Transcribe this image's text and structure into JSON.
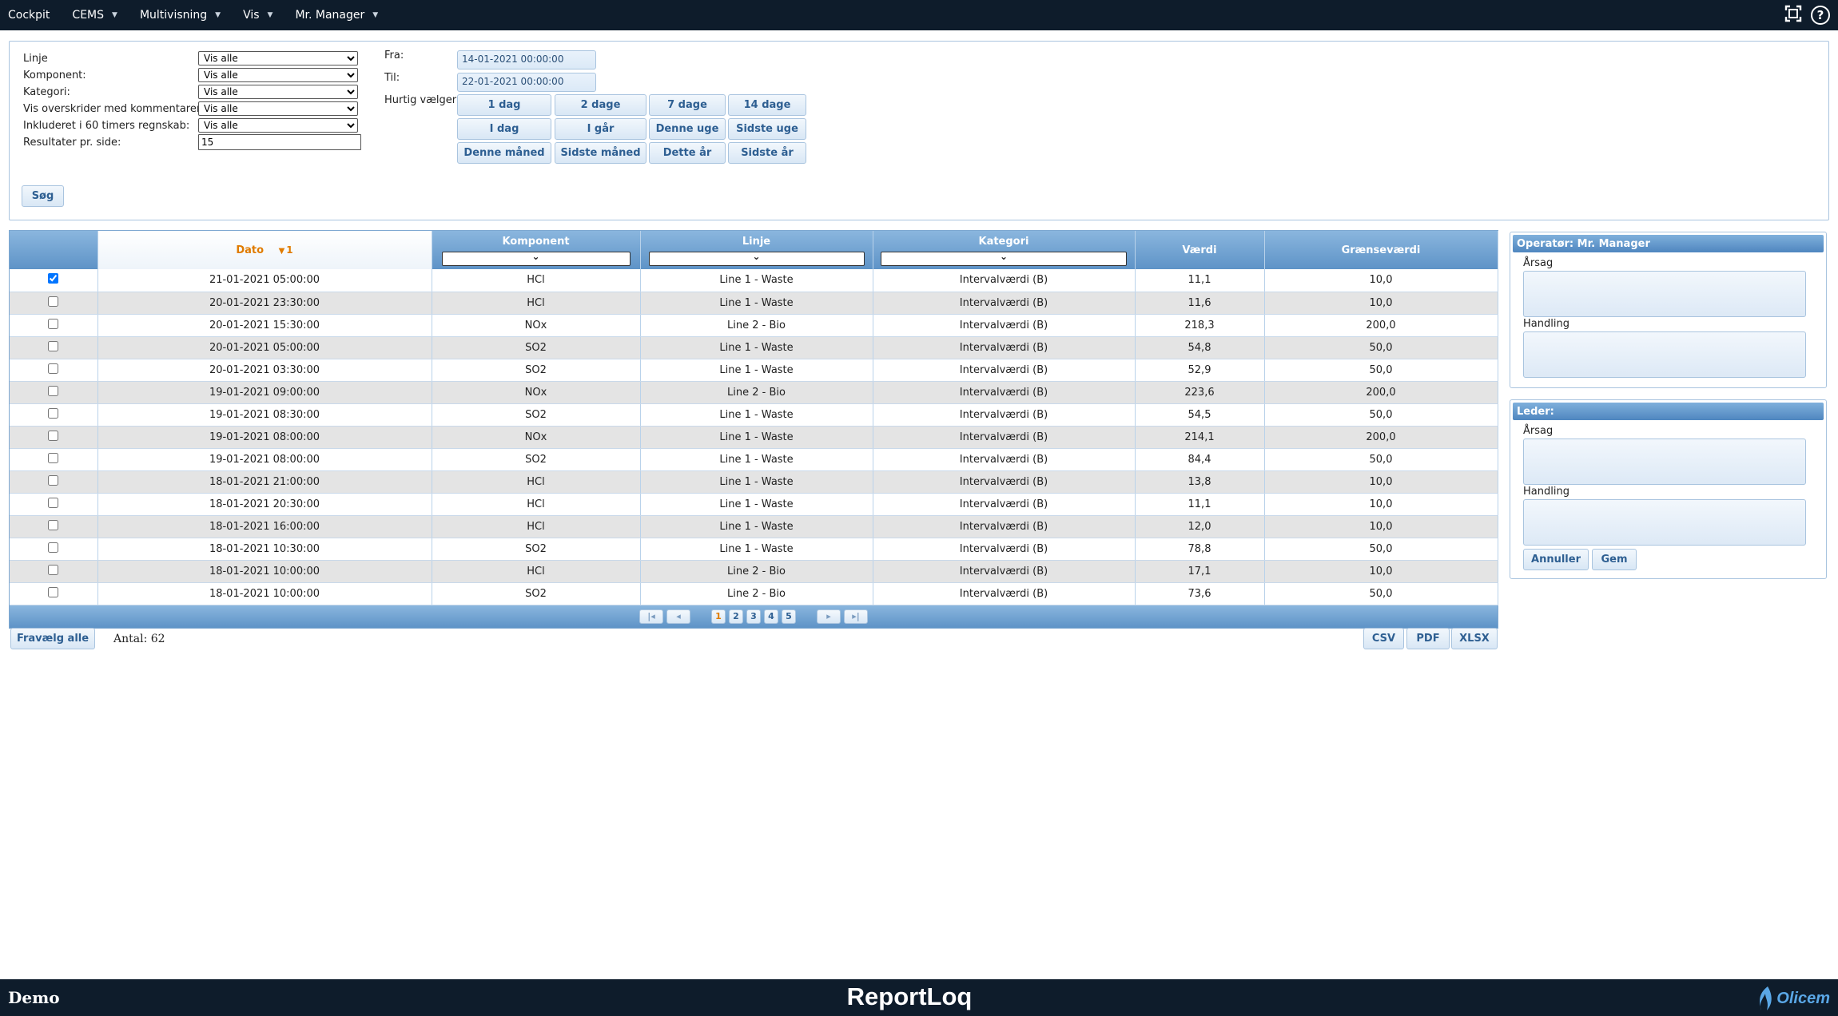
{
  "topbar": {
    "menu": [
      {
        "label": "Cockpit",
        "caret": false
      },
      {
        "label": "CEMS",
        "caret": true
      },
      {
        "label": "Multivisning",
        "caret": true
      },
      {
        "label": "Vis",
        "caret": true
      },
      {
        "label": "Mr. Manager",
        "caret": true
      }
    ],
    "help": "?"
  },
  "filters": {
    "linje_label": "Linje",
    "linje_value": "Vis alle",
    "komponent_label": "Komponent:",
    "komponent_value": "Vis alle",
    "kategori_label": "Kategori:",
    "kategori_value": "Vis alle",
    "overskrider_label": "Vis overskrider med kommentarer:",
    "overskrider_value": "Vis alle",
    "regnskab_label": "Inkluderet i 60 timers regnskab:",
    "regnskab_value": "Vis alle",
    "results_label": "Resultater pr. side:",
    "results_value": "15",
    "fra_label": "Fra:",
    "fra_value": "14-01-2021 00:00:00",
    "til_label": "Til:",
    "til_value": "22-01-2021 00:00:00",
    "quick_label": "Hurtig vælger:",
    "quick": [
      "1 dag",
      "2 dage",
      "7 dage",
      "14 dage",
      "I dag",
      "I går",
      "Denne uge",
      "Sidste uge",
      "Denne måned",
      "Sidste måned",
      "Dette år",
      "Sidste år"
    ],
    "search_label": "Søg"
  },
  "grid": {
    "headers": {
      "dato": "Dato",
      "sort_indicator": "1",
      "komponent": "Komponent",
      "linje": "Linje",
      "kategori": "Kategori",
      "vaerdi": "Værdi",
      "graense": "Grænseværdi"
    },
    "rows": [
      {
        "checked": true,
        "date": "21-01-2021 05:00:00",
        "component": "HCl",
        "line": "Line 1 - Waste",
        "category": "Intervalværdi (B)",
        "value": "11,1",
        "limit": "10,0"
      },
      {
        "checked": false,
        "date": "20-01-2021 23:30:00",
        "component": "HCl",
        "line": "Line 1 - Waste",
        "category": "Intervalværdi (B)",
        "value": "11,6",
        "limit": "10,0"
      },
      {
        "checked": false,
        "date": "20-01-2021 15:30:00",
        "component": "NOx",
        "line": "Line 2 - Bio",
        "category": "Intervalværdi (B)",
        "value": "218,3",
        "limit": "200,0"
      },
      {
        "checked": false,
        "date": "20-01-2021 05:00:00",
        "component": "SO2",
        "line": "Line 1 - Waste",
        "category": "Intervalværdi (B)",
        "value": "54,8",
        "limit": "50,0"
      },
      {
        "checked": false,
        "date": "20-01-2021 03:30:00",
        "component": "SO2",
        "line": "Line 1 - Waste",
        "category": "Intervalværdi (B)",
        "value": "52,9",
        "limit": "50,0"
      },
      {
        "checked": false,
        "date": "19-01-2021 09:00:00",
        "component": "NOx",
        "line": "Line 2 - Bio",
        "category": "Intervalværdi (B)",
        "value": "223,6",
        "limit": "200,0"
      },
      {
        "checked": false,
        "date": "19-01-2021 08:30:00",
        "component": "SO2",
        "line": "Line 1 - Waste",
        "category": "Intervalværdi (B)",
        "value": "54,5",
        "limit": "50,0"
      },
      {
        "checked": false,
        "date": "19-01-2021 08:00:00",
        "component": "NOx",
        "line": "Line 1 - Waste",
        "category": "Intervalværdi (B)",
        "value": "214,1",
        "limit": "200,0"
      },
      {
        "checked": false,
        "date": "19-01-2021 08:00:00",
        "component": "SO2",
        "line": "Line 1 - Waste",
        "category": "Intervalværdi (B)",
        "value": "84,4",
        "limit": "50,0"
      },
      {
        "checked": false,
        "date": "18-01-2021 21:00:00",
        "component": "HCl",
        "line": "Line 1 - Waste",
        "category": "Intervalværdi (B)",
        "value": "13,8",
        "limit": "10,0"
      },
      {
        "checked": false,
        "date": "18-01-2021 20:30:00",
        "component": "HCl",
        "line": "Line 1 - Waste",
        "category": "Intervalværdi (B)",
        "value": "11,1",
        "limit": "10,0"
      },
      {
        "checked": false,
        "date": "18-01-2021 16:00:00",
        "component": "HCl",
        "line": "Line 1 - Waste",
        "category": "Intervalværdi (B)",
        "value": "12,0",
        "limit": "10,0"
      },
      {
        "checked": false,
        "date": "18-01-2021 10:30:00",
        "component": "SO2",
        "line": "Line 1 - Waste",
        "category": "Intervalværdi (B)",
        "value": "78,8",
        "limit": "50,0"
      },
      {
        "checked": false,
        "date": "18-01-2021 10:00:00",
        "component": "HCl",
        "line": "Line 2 - Bio",
        "category": "Intervalværdi (B)",
        "value": "17,1",
        "limit": "10,0"
      },
      {
        "checked": false,
        "date": "18-01-2021 10:00:00",
        "component": "SO2",
        "line": "Line 2 - Bio",
        "category": "Intervalværdi (B)",
        "value": "73,6",
        "limit": "50,0"
      }
    ],
    "pager": {
      "pages": [
        "1",
        "2",
        "3",
        "4",
        "5"
      ],
      "current": "1"
    }
  },
  "actions": {
    "deselect_all": "Fravælg alle",
    "count": "Antal: 62",
    "csv": "CSV",
    "pdf": "PDF",
    "xlsx": "XLSX"
  },
  "operator_panel": {
    "title": "Operatør: Mr. Manager",
    "reason_label": "Årsag",
    "action_label": "Handling"
  },
  "leader_panel": {
    "title": "Leder:",
    "reason_label": "Årsag",
    "action_label": "Handling",
    "cancel": "Annuller",
    "save": "Gem"
  },
  "footer": {
    "left": "Demo",
    "brand": "ReportLoq",
    "logo": "Olicem"
  },
  "colors": {
    "topbar": "#0e1c2b",
    "header_blue": "#6a9fd0",
    "sort_orange": "#e07b00",
    "row_alt": "#e4e4e4",
    "button_text": "#2e5f92"
  }
}
